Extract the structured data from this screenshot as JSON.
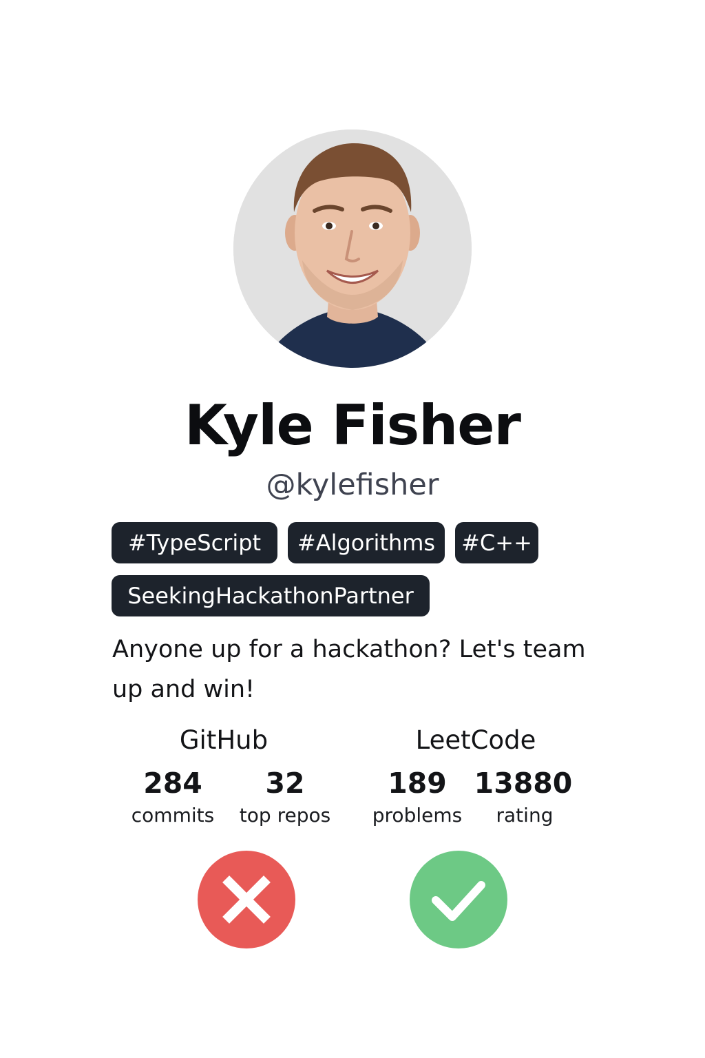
{
  "profile": {
    "name": "Kyle Fisher",
    "handle": "@kylefisher",
    "tags": [
      "#TypeScript",
      "#Algorithms",
      "#C++",
      "SeekingHackathonPartner"
    ],
    "bio": "Anyone up for a hackathon? Let's team up and win!"
  },
  "stats": {
    "github": {
      "title": "GitHub",
      "commits": {
        "value": "284",
        "label": "commits"
      },
      "repos": {
        "value": "32",
        "label": "top repos"
      }
    },
    "leetcode": {
      "title": "LeetCode",
      "problems": {
        "value": "189",
        "label": "problems"
      },
      "rating": {
        "value": "13880",
        "label": "rating"
      }
    }
  },
  "actions": {
    "reject": {
      "icon": "x-icon",
      "color": "#e85a57"
    },
    "accept": {
      "icon": "checkmark-icon",
      "color": "#6dc985"
    }
  }
}
